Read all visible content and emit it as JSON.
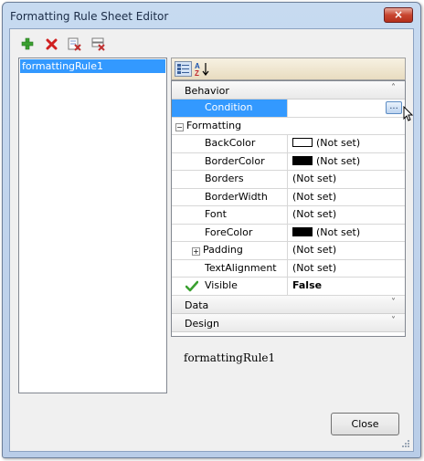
{
  "window": {
    "title": "Formatting Rule Sheet Editor",
    "close_glyph": "×"
  },
  "toolbar": {
    "buttons": [
      {
        "name": "add-rule",
        "icon": "plus-icon",
        "color": "#3aa030"
      },
      {
        "name": "remove-rule",
        "icon": "x-icon",
        "color": "#d02020"
      },
      {
        "name": "remove-unused",
        "icon": "delete-list-icon",
        "color": "#c03030"
      },
      {
        "name": "purge-rules",
        "icon": "purge-icon",
        "color": "#c03030"
      }
    ]
  },
  "rules": {
    "items": [
      "formattingRule1"
    ]
  },
  "property_grid": {
    "categories": {
      "behavior": "Behavior",
      "data": "Data",
      "design": "Design"
    },
    "chevron_up": "˄",
    "chevron_down": "˅",
    "rows": {
      "condition": {
        "name": "Condition",
        "value": ""
      },
      "formatting": {
        "name": "Formatting",
        "expander": "−"
      },
      "backcolor": {
        "name": "BackColor",
        "value": "(Not set)",
        "swatch": "#ffffff"
      },
      "bordercolor": {
        "name": "BorderColor",
        "value": "(Not set)",
        "swatch": "#000000"
      },
      "borders": {
        "name": "Borders",
        "value": "(Not set)"
      },
      "borderwidth": {
        "name": "BorderWidth",
        "value": "(Not set)"
      },
      "font": {
        "name": "Font",
        "value": "(Not set)"
      },
      "forecolor": {
        "name": "ForeColor",
        "value": "(Not set)",
        "swatch": "#000000"
      },
      "padding": {
        "name": "Padding",
        "value": "(Not set)",
        "expander": "+"
      },
      "textalignment": {
        "name": "TextAlignment",
        "value": "(Not set)"
      },
      "visible": {
        "name": "Visible",
        "value": "False"
      }
    },
    "ellipsis": "..."
  },
  "selected_rule_label": "formattingRule1",
  "footer": {
    "close_label": "Close"
  },
  "colors": {
    "selection": "#3399ff",
    "title_bg": "#c7daf0",
    "close_red": "#c8452f"
  }
}
